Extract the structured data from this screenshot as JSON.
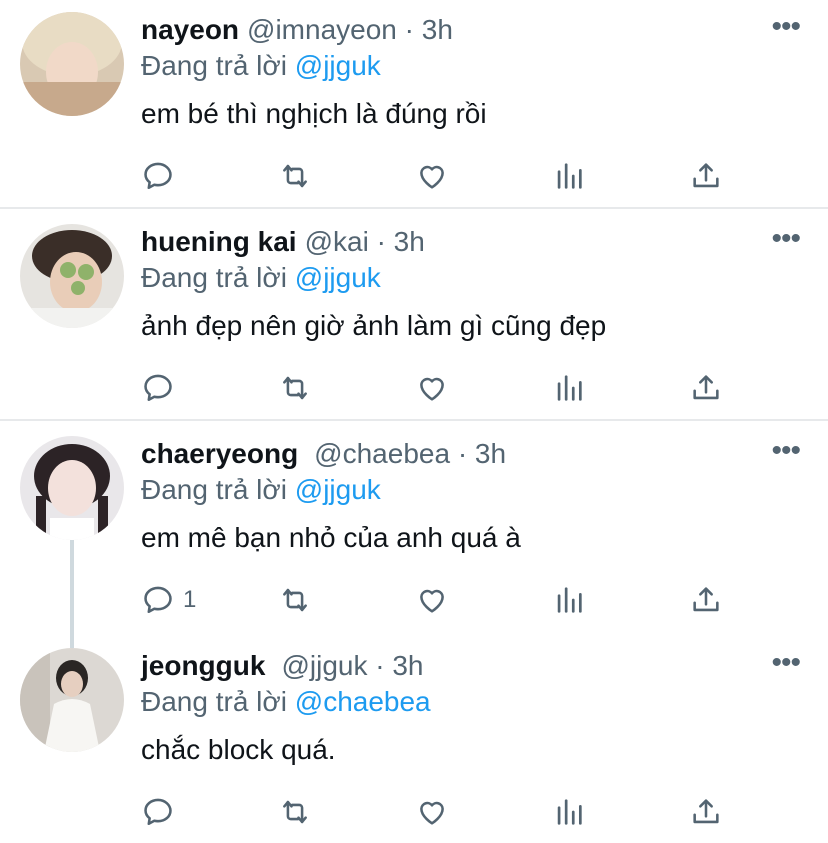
{
  "reply_prefix": "Đang trả lời",
  "colors": {
    "accent": "#1d9bf0",
    "muted": "#536471",
    "divider": "#e7e9eb"
  },
  "tweets": [
    {
      "name": "nayeon",
      "handle": "@imnayeon",
      "time": "· 3h",
      "reply_to": "@jjguk",
      "text": "em bé thì nghịch là đúng rồi",
      "reply_count": ""
    },
    {
      "name": "huening kai",
      "handle": "@kai",
      "time": "· 3h",
      "reply_to": "@jjguk",
      "text": "ảnh đẹp nên giờ ảnh làm gì cũng đẹp",
      "reply_count": ""
    },
    {
      "name": "chaeryeong",
      "handle": "@chaebea",
      "time": "· 3h",
      "reply_to": "@jjguk",
      "text": "em mê bạn nhỏ của anh quá à",
      "reply_count": "1"
    },
    {
      "name": "jeongguk",
      "handle": "@jjguk",
      "time": "· 3h",
      "reply_to": "@chaebea",
      "text": "chắc block quá.",
      "reply_count": ""
    }
  ],
  "icons": [
    "reply-icon",
    "retweet-icon",
    "like-icon",
    "analytics-icon",
    "share-icon",
    "more-icon"
  ]
}
